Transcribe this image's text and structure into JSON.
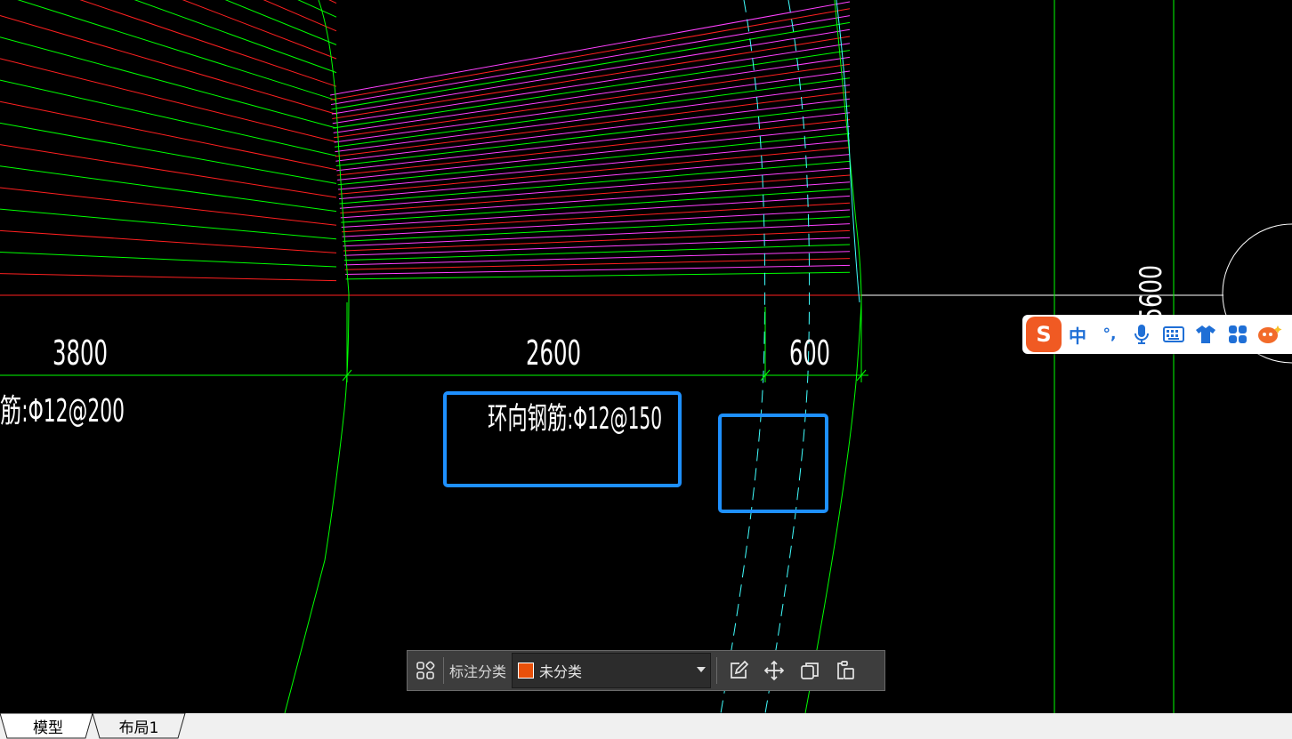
{
  "drawing": {
    "dimensions": [
      "3800",
      "2600",
      "600",
      "5600"
    ],
    "left_label": "筋:Φ12@200",
    "center_label": "环向钢筋:Φ12@150",
    "colors": {
      "background": "#000000",
      "green": "#00ff00",
      "red": "#ff2020",
      "magenta": "#ff40ff",
      "cyan": "#40ffff",
      "white": "#ffffff",
      "highlight": "#1e90ff"
    }
  },
  "toolbar": {
    "category_label": "标注分类",
    "category_value": "未分类",
    "swatch_color": "#e8500a",
    "icons": [
      "grid-icon",
      "edit-icon",
      "move-icon",
      "copy-icon",
      "paste-icon"
    ]
  },
  "ime": {
    "logo": "S",
    "mode": "中",
    "punct": "°,",
    "icons": [
      "microphone-icon",
      "keyboard-icon",
      "shirt-icon",
      "apps-icon",
      "mascot-icon"
    ]
  },
  "tabs": {
    "model": "模型",
    "layout1": "布局1"
  }
}
